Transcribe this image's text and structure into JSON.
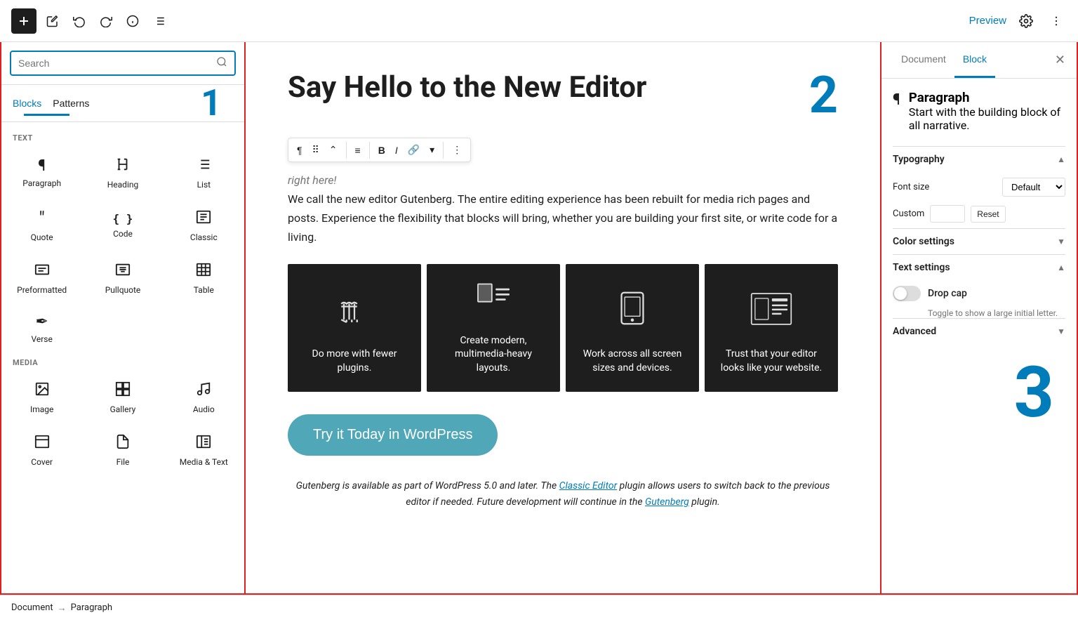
{
  "toolbar": {
    "add_label": "+",
    "preview_label": "Preview"
  },
  "left_panel": {
    "search_placeholder": "Search",
    "tab_blocks": "Blocks",
    "tab_patterns": "Patterns",
    "number_badge": "1",
    "section_text": "TEXT",
    "section_media": "MEDIA",
    "text_blocks": [
      {
        "label": "Paragraph",
        "icon": "¶"
      },
      {
        "label": "Heading",
        "icon": "🔖"
      },
      {
        "label": "List",
        "icon": "≡"
      },
      {
        "label": "Quote",
        "icon": "❝"
      },
      {
        "label": "Code",
        "icon": "<>"
      },
      {
        "label": "Classic",
        "icon": "⊞"
      },
      {
        "label": "Preformatted",
        "icon": "⊟"
      },
      {
        "label": "Pullquote",
        "icon": "⊠"
      },
      {
        "label": "Table",
        "icon": "⊞"
      },
      {
        "label": "Verse",
        "icon": "✒"
      }
    ],
    "media_blocks": [
      {
        "label": "Image",
        "icon": "🖼"
      },
      {
        "label": "Gallery",
        "icon": "🗃"
      },
      {
        "label": "Audio",
        "icon": "♪"
      }
    ]
  },
  "center_panel": {
    "page_title": "Say Hello to the New Editor",
    "number_badge": "2",
    "italic_hint": "right here!",
    "paragraph": "We call the new editor Gutenberg. The entire editing experience has been rebuilt for media rich pages and posts. Experience the flexibility that blocks will bring, whether you are building your first site, or write code for a living.",
    "feature_cards": [
      {
        "icon": "⚡",
        "text": "Do more with fewer plugins."
      },
      {
        "icon": "▦",
        "text": "Create modern, multimedia-heavy layouts."
      },
      {
        "icon": "📱",
        "text": "Work across all screen sizes and devices."
      },
      {
        "icon": "📰",
        "text": "Trust that your editor looks like your website."
      }
    ],
    "cta_label": "Try it Today in WordPress",
    "footer": "Gutenberg is available as part of WordPress 5.0 and later. The Classic Editor plugin allows users to switch back to the previous editor if needed. Future development will continue in the Gutenberg plugin.",
    "footer_link1": "Classic Editor",
    "footer_link2": "Gutenberg"
  },
  "right_panel": {
    "tab_document": "Document",
    "tab_block": "Block",
    "number_badge": "3",
    "block_name": "Paragraph",
    "block_desc": "Start with the building block of all narrative.",
    "typography_label": "Typography",
    "font_size_label": "Font size",
    "custom_label": "Custom",
    "font_size_default": "Default",
    "reset_label": "Reset",
    "color_settings_label": "Color settings",
    "text_settings_label": "Text settings",
    "drop_cap_label": "Drop cap",
    "drop_cap_desc": "Toggle to show a large initial letter.",
    "advanced_label": "Advanced"
  },
  "breadcrumb": {
    "item1": "Document",
    "sep": "→",
    "item2": "Paragraph"
  }
}
